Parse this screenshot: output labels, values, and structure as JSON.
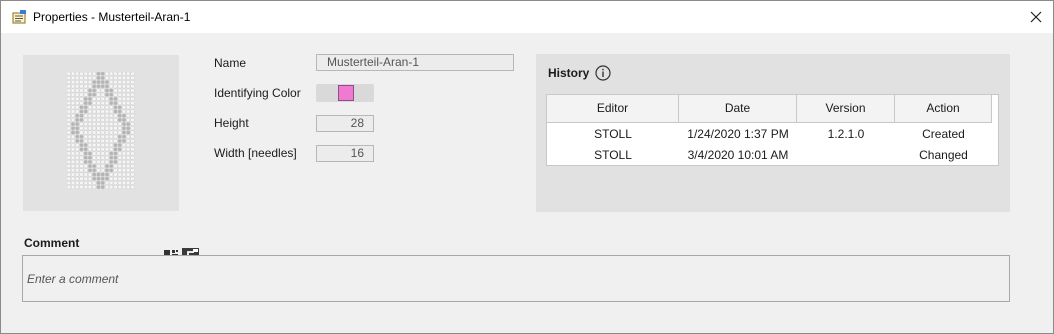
{
  "window": {
    "title": "Properties - Musterteil-Aran-1"
  },
  "properties": {
    "name_label": "Name",
    "name_value": "Musterteil-Aran-1",
    "color_label": "Identifying Color",
    "identifying_color": "#f07ad0",
    "height_label": "Height",
    "height_value": "28",
    "width_label": "Width [needles]",
    "width_value": "16"
  },
  "history": {
    "title": "History",
    "columns": [
      "Editor",
      "Date",
      "Version",
      "Action"
    ],
    "rows": [
      {
        "editor": "STOLL",
        "date": "1/24/2020 1:37 PM",
        "version": "1.2.1.0",
        "action": "Created"
      },
      {
        "editor": "STOLL",
        "date": "3/4/2020 10:01 AM",
        "version": "",
        "action": "Changed"
      }
    ]
  },
  "comment": {
    "label": "Comment",
    "placeholder": "Enter a comment",
    "value": ""
  },
  "icons": {
    "title": "properties-icon",
    "close": "close-icon",
    "info": "info-icon",
    "preview_grid": "pattern-grid-icon",
    "preview_mode": "pattern-mode-icon"
  }
}
